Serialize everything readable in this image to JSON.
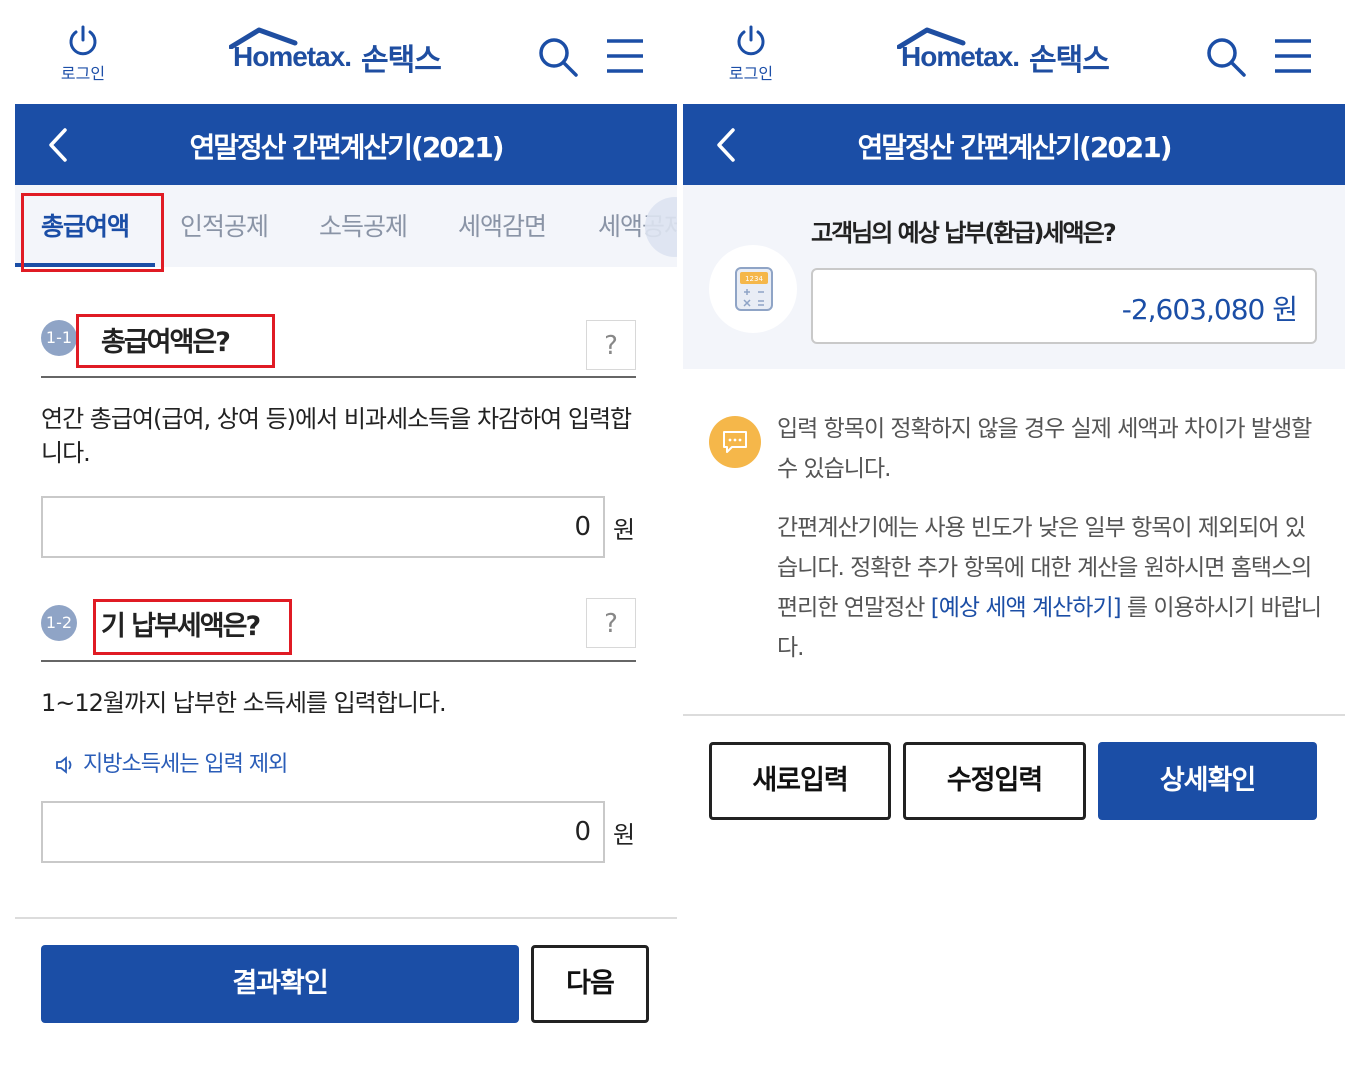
{
  "header": {
    "login_label": "로그인",
    "logo_en": "Hometax.",
    "logo_kr": "손택스",
    "title": "연말정산 간편계산기(2021)"
  },
  "tabs": [
    {
      "label": "총급여액",
      "active": true
    },
    {
      "label": "인적공제",
      "active": false
    },
    {
      "label": "소득공제",
      "active": false
    },
    {
      "label": "세액감면",
      "active": false
    },
    {
      "label": "세액공제",
      "active": false
    }
  ],
  "form": {
    "q1": {
      "number": "1-1",
      "title": "총급여액은?",
      "help": "?",
      "description": "연간 총급여(급여, 상여 등)에서 비과세소득을 차감하여 입력합니다.",
      "value": "0",
      "unit": "원"
    },
    "q2": {
      "number": "1-2",
      "title": "기 납부세액은?",
      "help": "?",
      "description": "1~12월까지 납부한 소득세를 입력합니다.",
      "note": "지방소득세는 입력 제외",
      "value": "0",
      "unit": "원"
    },
    "result_button": "결과확인",
    "next_button": "다음"
  },
  "result": {
    "question": "고객님의 예상 납부(환급)세액은?",
    "value": "-2,603,080 원",
    "info_1": "입력 항목이 정확하지 않을 경우 실제 세액과 차이가 발생할 수 있습니다.",
    "info_2_pre": "간편계산기에는 사용 빈도가 낮은 일부 항목이 제외되어 있습니다. 정확한 추가 항목에 대한 계산을 원하시면 홈택스의 편리한 연말정산 ",
    "info_2_link": "[예상 세액 계산하기]",
    "info_2_post": " 를 이용하시기 바랍니다.",
    "buttons": {
      "reset": "새로입력",
      "edit": "수정입력",
      "detail": "상세확인"
    }
  },
  "colors": {
    "brand_blue": "#1b4ea6",
    "highlight_red": "#e01b24",
    "info_orange": "#f5b74a"
  }
}
